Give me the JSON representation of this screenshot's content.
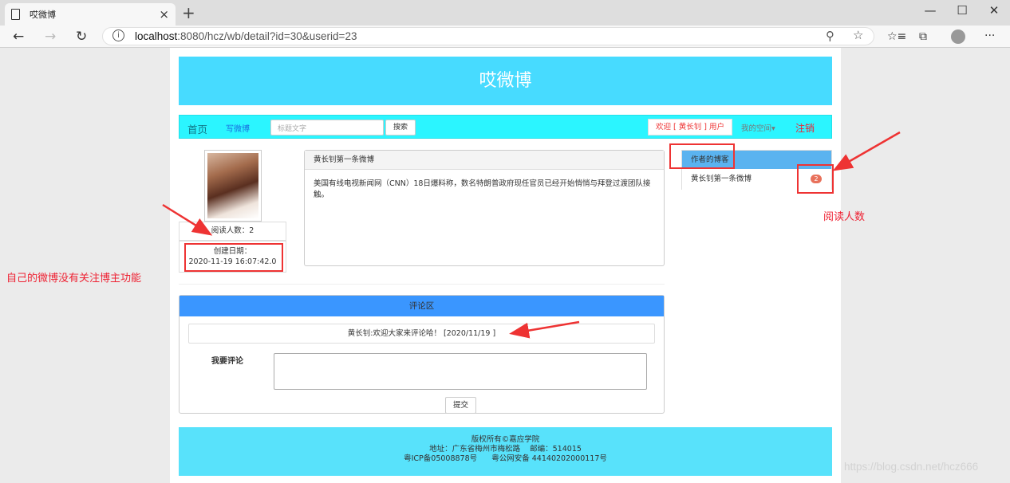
{
  "browser": {
    "tab_title": "哎微博",
    "tab_close": "×",
    "new_tab": "+",
    "url_host": "localhost",
    "url_path": ":8080/hcz/wb/detail?id=30&userid=23",
    "win_minimize": "—",
    "win_maximize": "☐",
    "win_close": "✕",
    "more_menu": "···"
  },
  "site": {
    "banner_title": "哎微博",
    "nav": {
      "home": "首页",
      "write": "写微博",
      "search_placeholder": "标题文字",
      "search_button": "搜索",
      "welcome": "欢迎 [ 黄长钊 ] 用户",
      "my_space": "我的空间▾",
      "logout": "注销"
    }
  },
  "author": {
    "read_count_text": "阅读人数：2",
    "created_label": "创建日期：",
    "created_value": "2020-11-19 16:07:42.0"
  },
  "post": {
    "title": "黄长钊第一条微博",
    "body": "美国有线电视新闻网（CNN）18日爆料称，数名特朗普政府现任官员已经开始悄悄与拜登过渡团队接触。"
  },
  "sidebar": {
    "header": "作者的博客",
    "items": [
      {
        "label": "黄长钊第一条微博",
        "badge": "2"
      }
    ]
  },
  "comments": {
    "header": "评论区",
    "items": [
      {
        "text": "黄长钊:欢迎大家来评论哈！ [2020/11/19 ]"
      }
    ],
    "my_comment_label": "我要评论",
    "submit_button": "提交"
  },
  "footer": {
    "line1": "版权所有©嘉应学院",
    "line2": "地址：广东省梅州市梅松路    邮编：514015",
    "line3": "粤ICP备05008878号      粤公网安备 44140202000117号"
  },
  "annotations": {
    "left_note": "自己的微博没有关注博主功能",
    "right_note": "阅读人数",
    "watermark": "https://blog.csdn.net/hcz666"
  },
  "colors": {
    "banner": "#47dbff",
    "navbar": "#2bf5ff",
    "annotation_red": "#e33333",
    "comment_header": "#3a96ff",
    "sidebar_header": "#5ab3f0",
    "footer": "#58e2fb"
  }
}
